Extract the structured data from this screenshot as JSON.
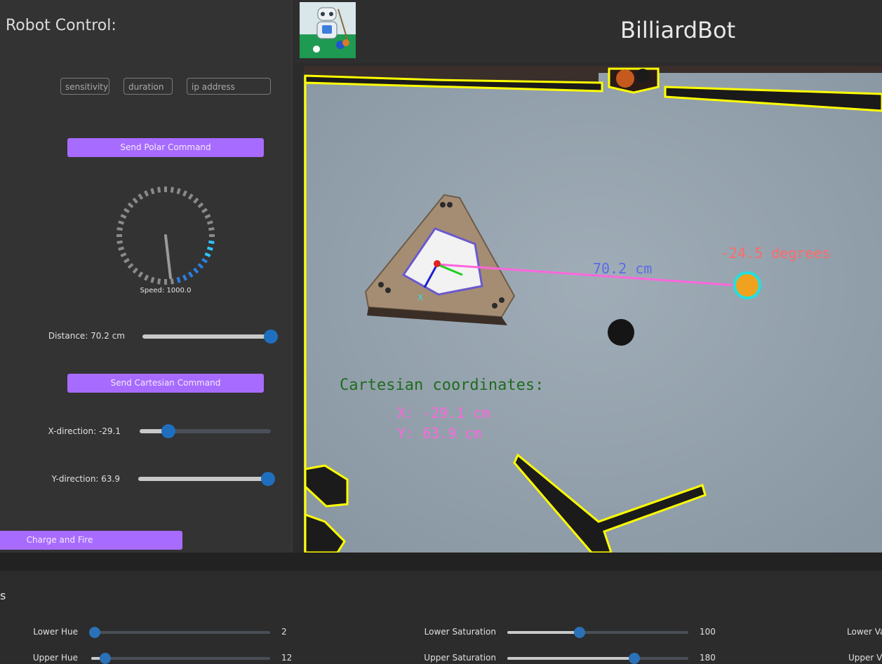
{
  "left_panel": {
    "title": "Robot Control:",
    "fields": {
      "sensitivity": "sensitivity",
      "duration": "duration",
      "ip": "ip address"
    },
    "buttons": {
      "polar": "Send Polar Command",
      "cartesian": "Send Cartesian Command",
      "fire": "Charge and Fire"
    },
    "speed_dial": {
      "label": "Speed: 1000.0",
      "value": 1000.0
    },
    "distance": {
      "label": "Distance: 70.2 cm",
      "fraction": 1.0
    },
    "x_direction": {
      "label": "X-direction: -29.1",
      "fraction": 0.22
    },
    "y_direction": {
      "label": "Y-direction: 63.9",
      "fraction": 0.96
    }
  },
  "header": {
    "title": "BilliardBot",
    "logo_icon": "robot-billiard-icon"
  },
  "video": {
    "distance_text": "70.2 cm",
    "angle_text": "-24.5 degrees",
    "cartesian_title": "Cartesian coordinates:",
    "x_text": "X: -29.1 cm",
    "y_text": "Y: 63.9 cm"
  },
  "bottom_panel": {
    "title_fragment": "s",
    "sliders": [
      {
        "label": "Lower Hue",
        "value": "2",
        "fraction": 0.02
      },
      {
        "label": "Upper Hue",
        "value": "12",
        "fraction": 0.08
      },
      {
        "label": "Lower Saturation",
        "value": "100",
        "fraction": 0.4
      },
      {
        "label": "Upper Saturation",
        "value": "180",
        "fraction": 0.7
      },
      {
        "label": "Lower Va",
        "value": ""
      },
      {
        "label": "Upper Va",
        "value": ""
      }
    ]
  },
  "colors": {
    "accent": "#a86bff",
    "knob": "#1f6fbf",
    "table": "#9aa7b1",
    "cushion": "#ffff00"
  }
}
